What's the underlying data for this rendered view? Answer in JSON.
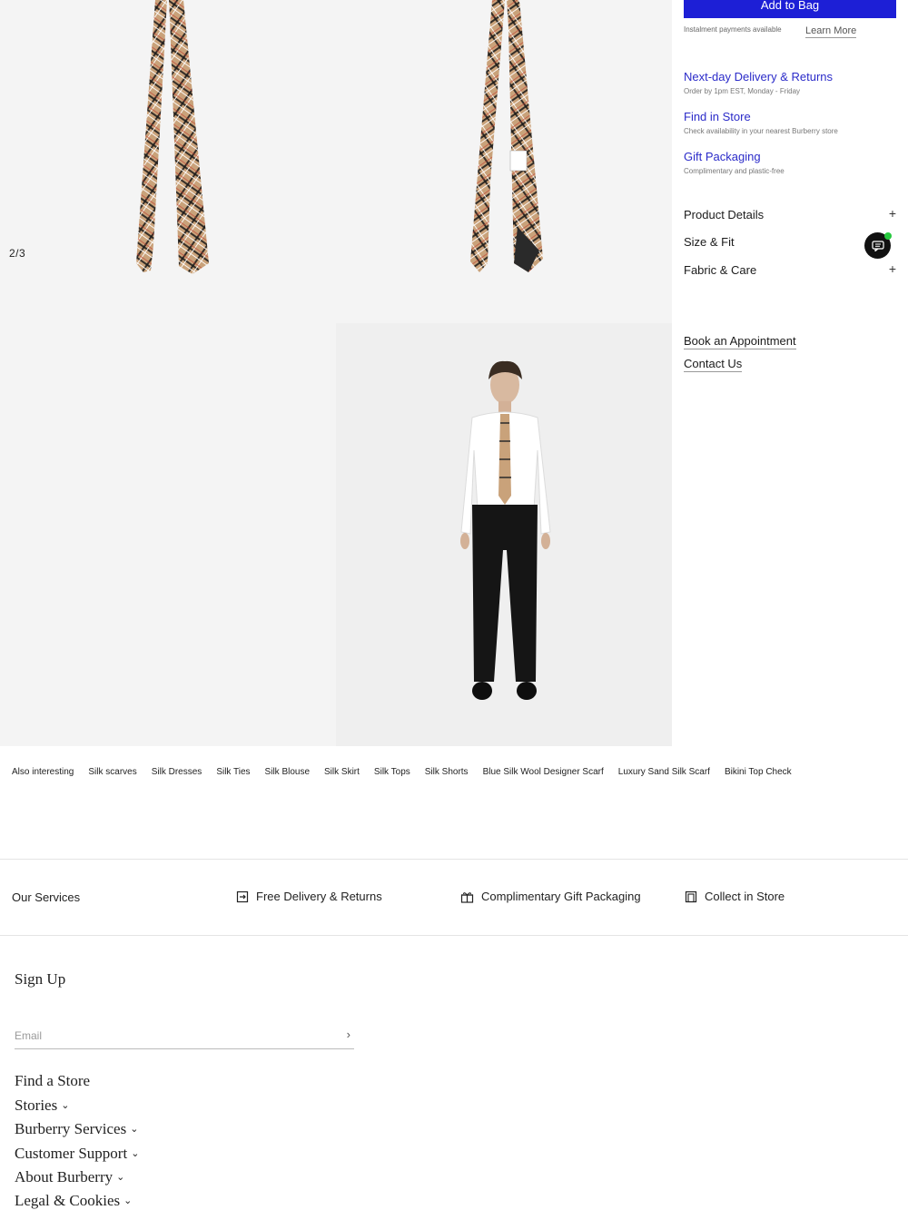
{
  "gallery": {
    "counter": "2/3",
    "images": [
      {
        "icon": "plaid-tie-front-image"
      },
      {
        "icon": "plaid-tie-back-image"
      },
      {
        "icon": "blank-image"
      },
      {
        "icon": "model-wearing-tie-image"
      }
    ]
  },
  "purchase": {
    "add_to_bag": "Add to Bag",
    "instalment": "Instalment payments available",
    "learn_more": "Learn More"
  },
  "services": [
    {
      "title": "Next-day Delivery & Returns",
      "subtitle": "Order by 1pm EST, Monday - Friday"
    },
    {
      "title": "Find in Store",
      "subtitle": "Check availability in your nearest Burberry store"
    },
    {
      "title": "Gift Packaging",
      "subtitle": "Complimentary and plastic-free"
    }
  ],
  "accordion": [
    {
      "label": "Product Details",
      "icon": "plus-icon"
    },
    {
      "label": "Size & Fit",
      "icon": "plus-icon"
    },
    {
      "label": "Fabric & Care",
      "icon": "plus-icon"
    }
  ],
  "panel_links": {
    "appointment": "Book an Appointment",
    "contact": "Contact Us"
  },
  "also_interesting": [
    "Also interesting",
    "Silk scarves",
    "Silk Dresses",
    "Silk Ties",
    "Silk Blouse",
    "Silk Skirt",
    "Silk Tops",
    "Silk Shorts",
    "Blue Silk Wool Designer Scarf",
    "Luxury Sand Silk Scarf",
    "Bikini Top Check"
  ],
  "our_services": {
    "title": "Our Services",
    "items": [
      {
        "label": "Free Delivery & Returns",
        "icon": "delivery-box-icon"
      },
      {
        "label": "Complimentary Gift Packaging",
        "icon": "gift-icon"
      },
      {
        "label": "Collect in Store",
        "icon": "store-icon"
      }
    ]
  },
  "footer": {
    "signup": "Sign Up",
    "email_placeholder": "Email",
    "links": [
      {
        "label": "Find a Store",
        "chevron": ""
      },
      {
        "label": "Stories",
        "chevron": "⌄"
      },
      {
        "label": "Burberry Services",
        "chevron": "⌄"
      },
      {
        "label": "Customer Support",
        "chevron": "⌄"
      },
      {
        "label": "About Burberry",
        "chevron": "⌄"
      },
      {
        "label": "Legal & Cookies",
        "chevron": "⌄"
      }
    ]
  },
  "colors": {
    "accent_blue": "#1d1fd6",
    "link_blue": "#2b2bc9",
    "tie_beige": "#c9a27a",
    "gallery_bg": "#f4f4f4"
  }
}
